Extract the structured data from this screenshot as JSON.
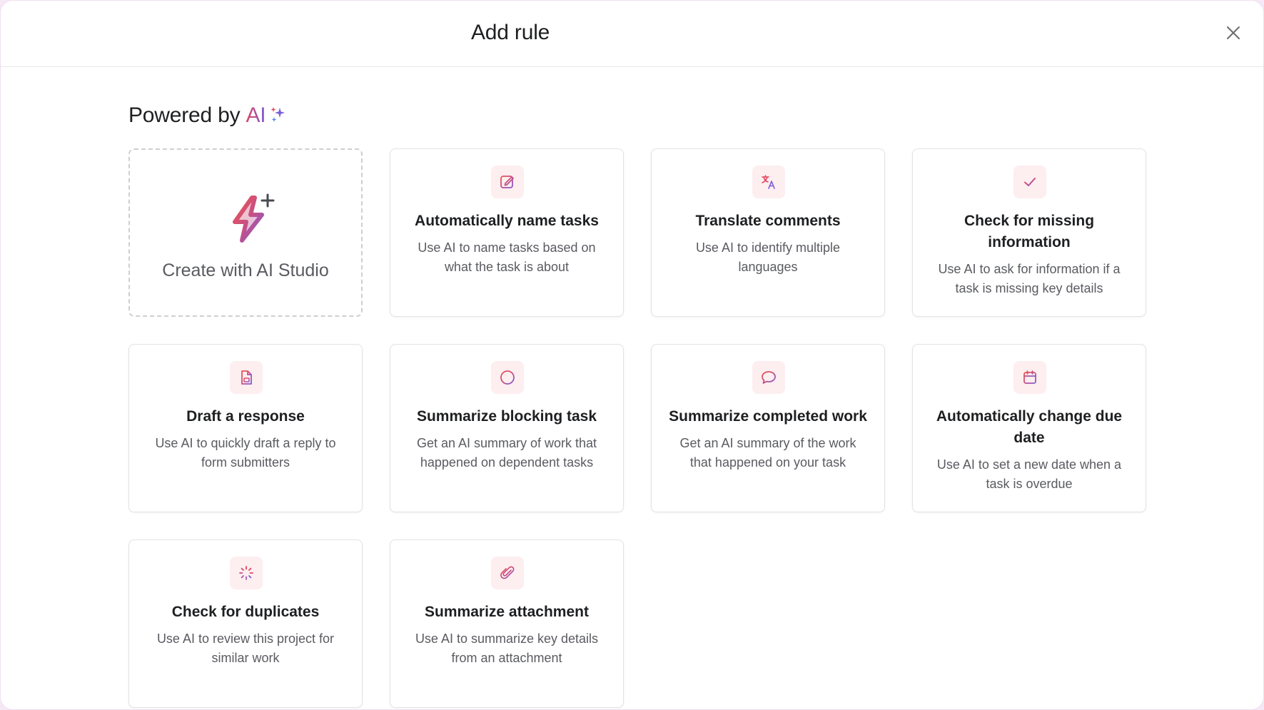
{
  "modal": {
    "title": "Add rule",
    "close_icon": "close-icon"
  },
  "section": {
    "heading_prefix": "Powered by",
    "heading_ai": "AI",
    "sparkle_icon": "sparkle-icon"
  },
  "studio_card": {
    "label": "Create with AI Studio",
    "icon": "lightning-plus-icon"
  },
  "cards": [
    {
      "title": "Automatically name tasks",
      "desc": "Use AI to name tasks based on what the task is about",
      "icon": "edit-icon"
    },
    {
      "title": "Translate comments",
      "desc": "Use AI to identify multiple languages",
      "icon": "translate-icon"
    },
    {
      "title": "Check for missing information",
      "desc": "Use AI to ask for information if a task is missing key details",
      "icon": "check-icon"
    },
    {
      "title": "Draft a response",
      "desc": "Use AI to quickly draft a reply to form submitters",
      "icon": "document-icon"
    },
    {
      "title": "Summarize blocking task",
      "desc": "Get an AI summary of work that happened on dependent tasks",
      "icon": "blocked-icon"
    },
    {
      "title": "Summarize completed work",
      "desc": "Get an AI summary of the work that happened on your task",
      "icon": "comment-icon"
    },
    {
      "title": "Automatically change due date",
      "desc": "Use AI to set a new date when a task is overdue",
      "icon": "calendar-icon"
    },
    {
      "title": "Check for duplicates",
      "desc": "Use AI to review this project for similar work",
      "icon": "loading-icon"
    },
    {
      "title": "Summarize attachment",
      "desc": "Use AI to summarize key details from an attachment",
      "icon": "paperclip-icon"
    }
  ],
  "colors": {
    "accent_red": "#e0435b",
    "accent_purple": "#7c5bd6",
    "icon_bg": "#fdeef0"
  }
}
